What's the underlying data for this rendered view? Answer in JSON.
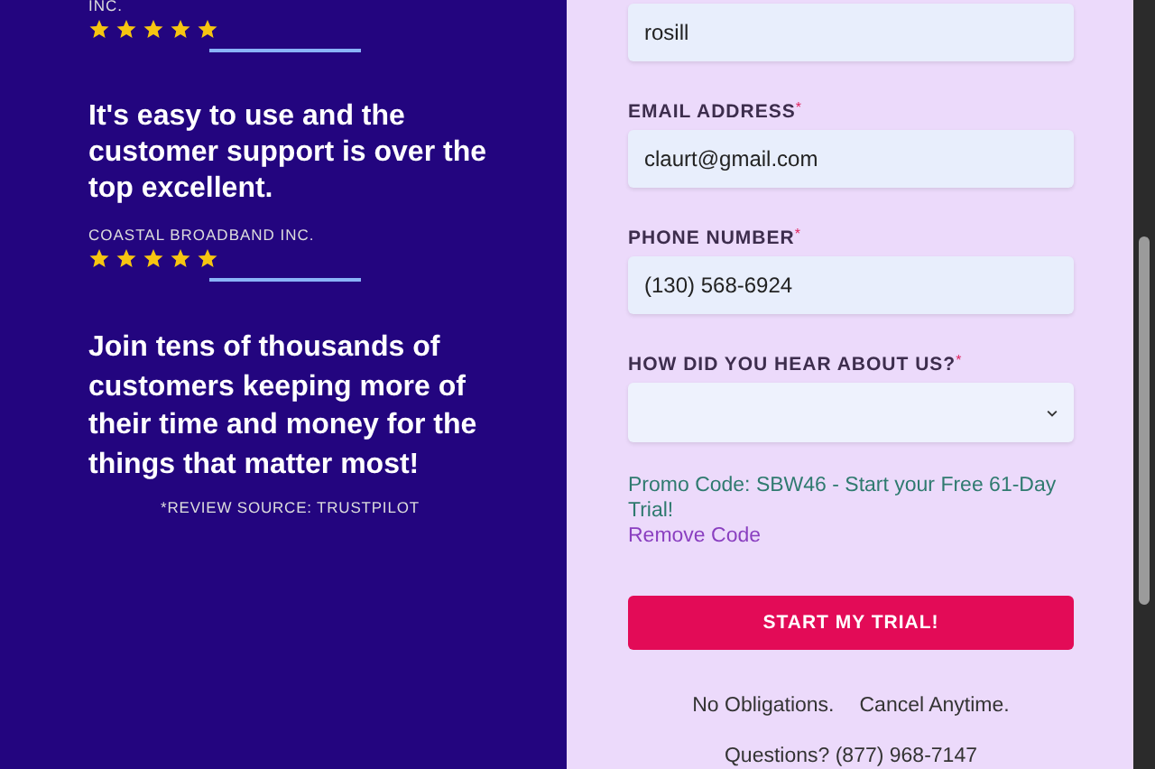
{
  "testimonials": [
    {
      "company": "INC.",
      "stars": 5
    },
    {
      "quote": "It's easy to use and the customer support is over the top excellent.",
      "company": "COASTAL BROADBAND INC.",
      "stars": 5
    }
  ],
  "tagline": "Join tens of thousands of customers keeping more of their time and money for the things that matter most!",
  "review_source": "*REVIEW SOURCE: TRUSTPILOT",
  "form": {
    "fields": [
      {
        "kind": "text",
        "value": "rosill"
      },
      {
        "kind": "text",
        "label": "EMAIL ADDRESS",
        "required_mark": "*",
        "value": "claurt@gmail.com"
      },
      {
        "kind": "text",
        "label": "PHONE NUMBER",
        "required_mark": "*",
        "value": "(130) 568-6924"
      },
      {
        "kind": "select",
        "label": "HOW DID YOU HEAR ABOUT US?",
        "required_mark": "*"
      }
    ],
    "promo": "Promo Code: SBW46 - Start your Free 61-Day Trial!",
    "remove_code": "Remove Code",
    "submit": "START MY TRIAL!",
    "notes": [
      "No Obligations.",
      "Cancel Anytime."
    ],
    "questions": "Questions? (877) 968-7147"
  }
}
